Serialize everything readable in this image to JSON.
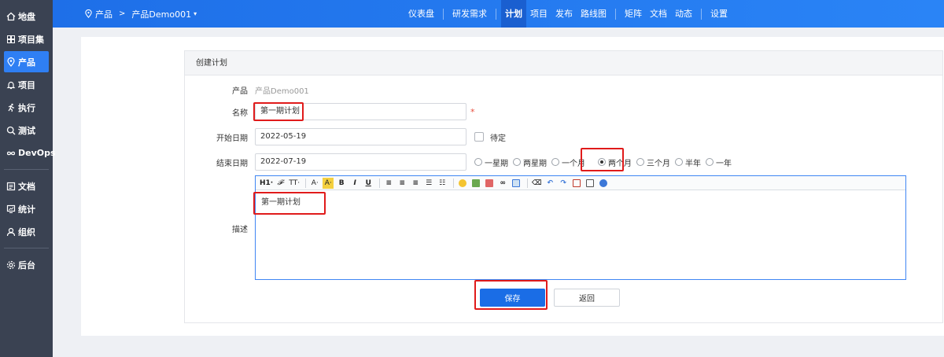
{
  "sidebar": {
    "items": [
      {
        "label": "地盘",
        "icon": "home-icon"
      },
      {
        "label": "项目集",
        "icon": "grid-icon"
      },
      {
        "label": "产品",
        "icon": "location-icon",
        "active": true
      },
      {
        "label": "项目",
        "icon": "bell-icon"
      },
      {
        "label": "执行",
        "icon": "run-icon"
      },
      {
        "label": "测试",
        "icon": "search-icon"
      },
      {
        "label": "DevOps",
        "icon": "infinity-icon"
      },
      {
        "label": "文档",
        "icon": "doc-icon"
      },
      {
        "label": "统计",
        "icon": "chart-icon"
      },
      {
        "label": "组织",
        "icon": "user-icon"
      },
      {
        "label": "后台",
        "icon": "gear-icon"
      }
    ]
  },
  "topbar": {
    "breadcrumb_root": "产品",
    "breadcrumb_current": "产品Demo001",
    "nav": [
      "仪表盘",
      "研发需求",
      "计划",
      "项目",
      "发布",
      "路线图",
      "矩阵",
      "文档",
      "动态",
      "设置"
    ],
    "active_nav": "计划"
  },
  "form": {
    "title": "创建计划",
    "product_label": "产品",
    "product_value": "产品Demo001",
    "name_label": "名称",
    "name_value": "第一期计划",
    "required_mark": "*",
    "start_label": "开始日期",
    "start_value": "2022-05-19",
    "pending_label": "待定",
    "end_label": "结束日期",
    "end_value": "2022-07-19",
    "duration_options": [
      "一星期",
      "两星期",
      "一个月",
      "两个月",
      "三个月",
      "半年",
      "一年"
    ],
    "duration_selected": "两个月",
    "desc_label": "描述",
    "desc_value": "第一期计划",
    "save_label": "保存",
    "back_label": "返回"
  },
  "editor_toolbar": {
    "h1": "H1·",
    "font": "𝓕·",
    "size": "TT·",
    "fontcolor": "A·",
    "bgcolor": "A·",
    "bold": "B",
    "italic": "I",
    "underline": "U"
  },
  "colors": {
    "sidebar_bg": "#3a4252",
    "topbar_bg": "#2a84f6",
    "accent": "#1a6de6",
    "highlight": "#e01b1b"
  }
}
